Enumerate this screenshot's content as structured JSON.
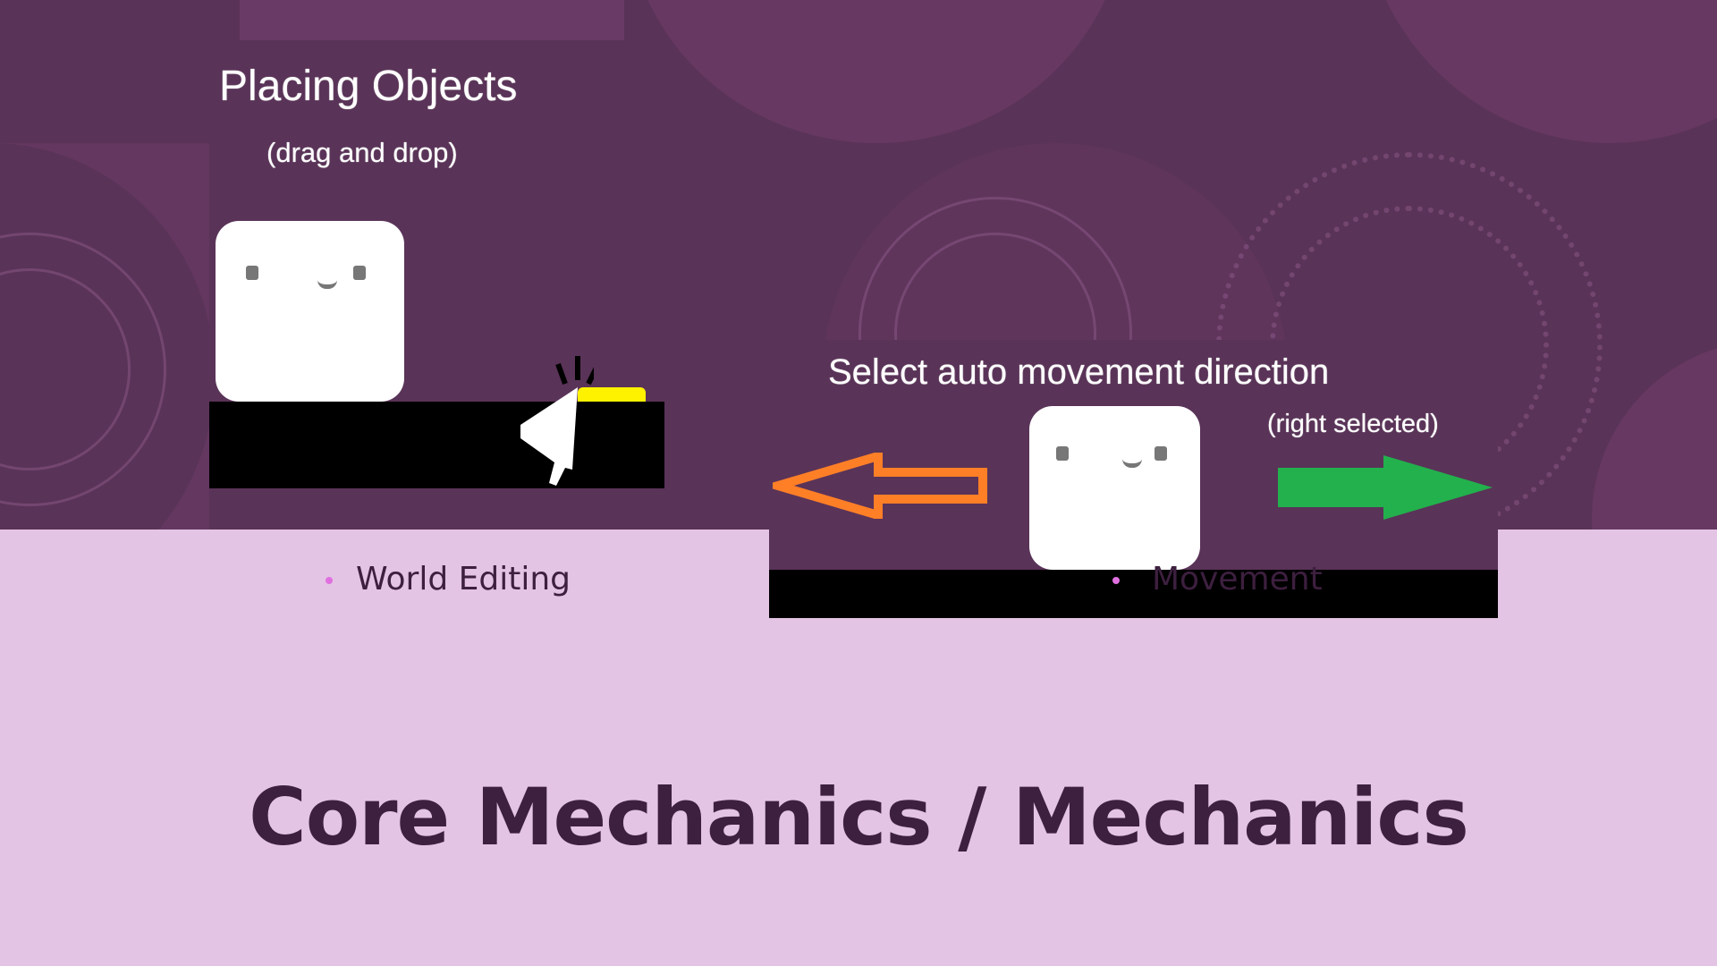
{
  "slide": {
    "title": "Core Mechanics / Mechanics",
    "bullets": [
      {
        "label": "World Editing"
      },
      {
        "label": "Movement"
      }
    ]
  },
  "placing_panel": {
    "title": "Placing Objects",
    "subtitle": "(drag and drop)"
  },
  "movement_panel": {
    "title": "Select auto movement direction",
    "note": "(right selected)",
    "left_arrow_color": "#ff7f27",
    "right_arrow_color": "#22b14c",
    "selected_direction": "right"
  },
  "colors": {
    "background_dark": "#5a3358",
    "background_light": "#e4c4e4",
    "title_text": "#3d2040",
    "bullet": "#e070e0",
    "highlight": "#fff200"
  }
}
